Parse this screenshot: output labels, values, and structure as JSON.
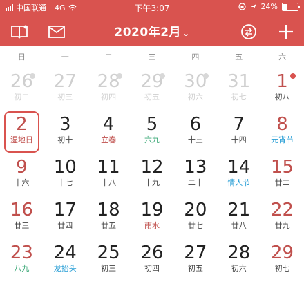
{
  "statusbar": {
    "carrier": "中国联通",
    "network": "4G",
    "time": "下午3:07",
    "battery": "24%",
    "battery_level": 0.24
  },
  "toolbar": {
    "title": "2020年2月",
    "title_chevron": "⌄",
    "icons": [
      "book-icon",
      "mail-icon",
      "chevron-down-icon",
      "return-to-today-icon",
      "add-icon"
    ]
  },
  "weekdays": [
    "日",
    "一",
    "二",
    "三",
    "四",
    "五",
    "六"
  ],
  "calendar": {
    "days": [
      {
        "num": "26",
        "lunar": "初二",
        "type": "other",
        "dot": "grey"
      },
      {
        "num": "27",
        "lunar": "初三",
        "type": "other",
        "dot": ""
      },
      {
        "num": "28",
        "lunar": "初四",
        "type": "other",
        "dot": "grey"
      },
      {
        "num": "29",
        "lunar": "初五",
        "type": "other",
        "dot": "grey"
      },
      {
        "num": "30",
        "lunar": "初六",
        "type": "other",
        "dot": "grey"
      },
      {
        "num": "31",
        "lunar": "初七",
        "type": "other",
        "dot": ""
      },
      {
        "num": "1",
        "lunar": "初八",
        "type": "weekend",
        "dot": "red"
      },
      {
        "num": "2",
        "lunar": "湿地日",
        "type": "selected",
        "dot": ""
      },
      {
        "num": "3",
        "lunar": "初十",
        "type": "normal",
        "dot": ""
      },
      {
        "num": "4",
        "lunar": "立春",
        "type": "red-term",
        "dot": ""
      },
      {
        "num": "5",
        "lunar": "六九",
        "type": "term",
        "dot": ""
      },
      {
        "num": "6",
        "lunar": "十三",
        "type": "normal",
        "dot": ""
      },
      {
        "num": "7",
        "lunar": "十四",
        "type": "normal",
        "dot": ""
      },
      {
        "num": "8",
        "lunar": "元宵节",
        "type": "weekend festival",
        "dot": ""
      },
      {
        "num": "9",
        "lunar": "十六",
        "type": "weekend",
        "dot": ""
      },
      {
        "num": "10",
        "lunar": "十七",
        "type": "normal",
        "dot": ""
      },
      {
        "num": "11",
        "lunar": "十八",
        "type": "normal",
        "dot": ""
      },
      {
        "num": "12",
        "lunar": "十九",
        "type": "normal",
        "dot": ""
      },
      {
        "num": "13",
        "lunar": "二十",
        "type": "normal",
        "dot": ""
      },
      {
        "num": "14",
        "lunar": "情人节",
        "type": "festival",
        "dot": ""
      },
      {
        "num": "15",
        "lunar": "廿二",
        "type": "weekend",
        "dot": ""
      },
      {
        "num": "16",
        "lunar": "廿三",
        "type": "weekend",
        "dot": ""
      },
      {
        "num": "17",
        "lunar": "廿四",
        "type": "normal",
        "dot": ""
      },
      {
        "num": "18",
        "lunar": "廿五",
        "type": "normal",
        "dot": ""
      },
      {
        "num": "19",
        "lunar": "雨水",
        "type": "red-term",
        "dot": ""
      },
      {
        "num": "20",
        "lunar": "廿七",
        "type": "normal",
        "dot": ""
      },
      {
        "num": "21",
        "lunar": "廿八",
        "type": "normal",
        "dot": ""
      },
      {
        "num": "22",
        "lunar": "廿九",
        "type": "weekend",
        "dot": ""
      },
      {
        "num": "23",
        "lunar": "八九",
        "type": "weekend term",
        "dot": ""
      },
      {
        "num": "24",
        "lunar": "龙抬头",
        "type": "festival",
        "dot": ""
      },
      {
        "num": "25",
        "lunar": "初三",
        "type": "normal",
        "dot": ""
      },
      {
        "num": "26",
        "lunar": "初四",
        "type": "normal",
        "dot": ""
      },
      {
        "num": "27",
        "lunar": "初五",
        "type": "normal",
        "dot": ""
      },
      {
        "num": "28",
        "lunar": "初六",
        "type": "normal",
        "dot": ""
      },
      {
        "num": "29",
        "lunar": "初七",
        "type": "weekend",
        "dot": ""
      }
    ]
  },
  "colors": {
    "header_bg": "#d9534f",
    "weekend": "#c0504d",
    "festival": "#2a9fd6",
    "term": "#3aa876"
  }
}
